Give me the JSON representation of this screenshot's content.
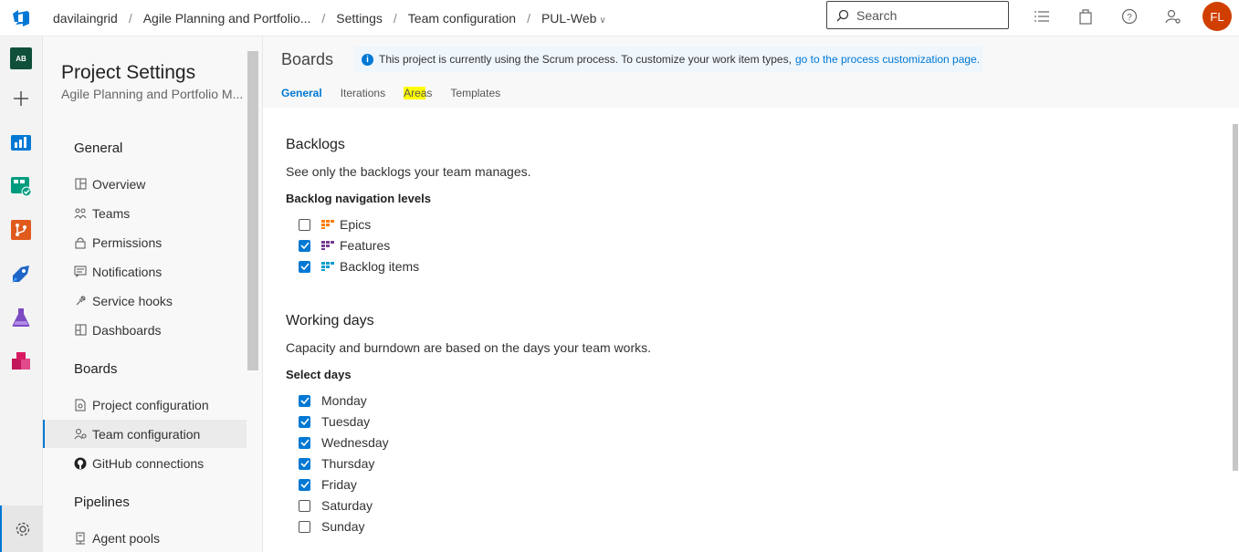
{
  "breadcrumb": {
    "org": "davilaingrid",
    "project": "Agile Planning and Portfolio...",
    "settings": "Settings",
    "page": "Team configuration",
    "team": "PUL-Web"
  },
  "search": {
    "placeholder": "Search"
  },
  "user": {
    "initials": "FL",
    "avatar_color": "#d13f00"
  },
  "rail": {
    "project_badge": "AB"
  },
  "settings_nav": {
    "title": "Project Settings",
    "subtitle": "Agile Planning and Portfolio M...",
    "groups": {
      "general": "General",
      "boards": "Boards",
      "pipelines": "Pipelines"
    },
    "items": {
      "overview": "Overview",
      "teams": "Teams",
      "permissions": "Permissions",
      "notifications": "Notifications",
      "service_hooks": "Service hooks",
      "dashboards": "Dashboards",
      "project_configuration": "Project configuration",
      "team_configuration": "Team configuration",
      "github_connections": "GitHub connections",
      "agent_pools": "Agent pools"
    }
  },
  "content": {
    "title": "Boards",
    "info": {
      "text": "This project is currently using the Scrum process. To customize your work item types,",
      "link": "go to the process customization page."
    },
    "tabs": {
      "general": "General",
      "iterations": "Iterations",
      "areas": "Areas",
      "templates": "Templates"
    },
    "backlogs": {
      "heading": "Backlogs",
      "description": "See only the backlogs your team manages.",
      "levels_label": "Backlog navigation levels",
      "levels": [
        {
          "label": "Epics",
          "checked": false,
          "icon": "epic-icon",
          "color": "#ff7b00"
        },
        {
          "label": "Features",
          "checked": true,
          "icon": "feature-icon",
          "color": "#773b93"
        },
        {
          "label": "Backlog items",
          "checked": true,
          "icon": "backlog-item-icon",
          "color": "#009ccc"
        }
      ]
    },
    "working_days": {
      "heading": "Working days",
      "description": "Capacity and burndown are based on the days your team works.",
      "select_label": "Select days",
      "days": [
        {
          "label": "Monday",
          "checked": true
        },
        {
          "label": "Tuesday",
          "checked": true
        },
        {
          "label": "Wednesday",
          "checked": true
        },
        {
          "label": "Thursday",
          "checked": true
        },
        {
          "label": "Friday",
          "checked": true
        },
        {
          "label": "Saturday",
          "checked": false
        },
        {
          "label": "Sunday",
          "checked": false
        }
      ]
    }
  },
  "colors": {
    "accent": "#0078d4",
    "highlight": "#ffff00"
  }
}
